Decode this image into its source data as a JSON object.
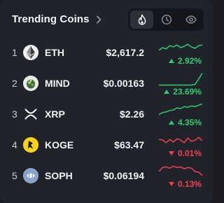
{
  "header": {
    "title": "Trending Coins",
    "tabs": [
      {
        "icon": "flame-icon",
        "active": true
      },
      {
        "icon": "clock-icon",
        "active": false
      },
      {
        "icon": "eye-icon",
        "active": false
      }
    ]
  },
  "colors": {
    "up": "#2ecc71",
    "down": "#f0414f",
    "background": "#21232a"
  },
  "coins": [
    {
      "rank": "1",
      "symbol": "ETH",
      "price": "$2,617.2",
      "change": "2.92%",
      "direction": "up",
      "logo": "eth-logo-icon",
      "trend": [
        0.35,
        0.55,
        0.45,
        0.7,
        0.6,
        0.75,
        0.55,
        0.65,
        0.8,
        0.6,
        0.5,
        0.7,
        0.75
      ]
    },
    {
      "rank": "2",
      "symbol": "MIND",
      "price": "$0.00163",
      "change": "23.69%",
      "direction": "up",
      "logo": "mind-logo-icon",
      "trend": [
        0.05,
        0.05,
        0.05,
        0.05,
        0.05,
        0.05,
        0.05,
        0.05,
        0.05,
        0.05,
        0.1,
        0.5,
        0.95
      ]
    },
    {
      "rank": "3",
      "symbol": "XRP",
      "price": "$2.26",
      "change": "4.35%",
      "direction": "up",
      "logo": "xrp-logo-icon",
      "trend": [
        0.15,
        0.3,
        0.35,
        0.45,
        0.5,
        0.65,
        0.6,
        0.75,
        0.7,
        0.8,
        0.75,
        0.85,
        0.95
      ]
    },
    {
      "rank": "4",
      "symbol": "KOGE",
      "price": "$63.47",
      "change": "0.01%",
      "direction": "down",
      "logo": "koge-logo-icon",
      "trend": [
        0.6,
        0.55,
        0.35,
        0.6,
        0.4,
        0.65,
        0.55,
        0.35,
        0.7,
        0.45,
        0.55,
        0.75,
        0.5
      ]
    },
    {
      "rank": "5",
      "symbol": "SOPH",
      "price": "$0.06194",
      "change": "0.13%",
      "direction": "down",
      "logo": "soph-logo-icon",
      "trend": [
        0.5,
        0.8,
        0.85,
        0.75,
        0.9,
        0.8,
        0.85,
        0.7,
        0.8,
        0.75,
        0.5,
        0.45,
        0.2
      ]
    }
  ]
}
